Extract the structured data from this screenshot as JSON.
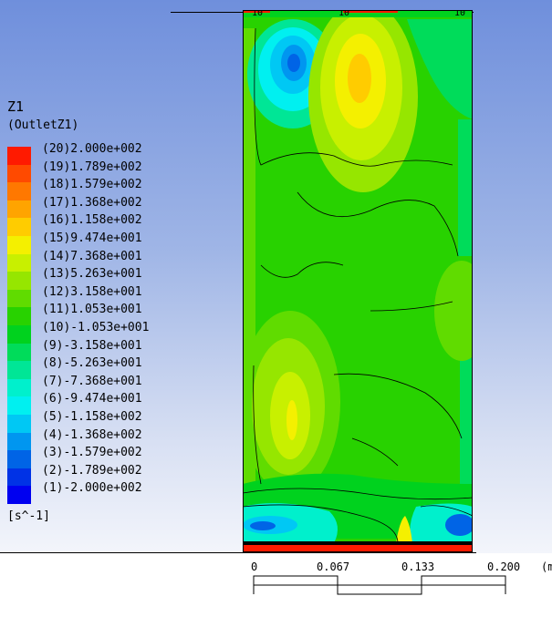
{
  "legend": {
    "title": "Z1",
    "subtitle": "(OutletZ1)",
    "units": "[s^-1]",
    "levels": [
      {
        "label": "(20)2.000e+002",
        "color": "#ff1a00"
      },
      {
        "label": "(19)1.789e+002",
        "color": "#ff4a00"
      },
      {
        "label": "(18)1.579e+002",
        "color": "#ff7800"
      },
      {
        "label": "(17)1.368e+002",
        "color": "#ffa400"
      },
      {
        "label": "(16)1.158e+002",
        "color": "#ffcc00"
      },
      {
        "label": "(15)9.474e+001",
        "color": "#f4f000"
      },
      {
        "label": "(14)7.368e+001",
        "color": "#c8f000"
      },
      {
        "label": "(13)5.263e+001",
        "color": "#96e600"
      },
      {
        "label": "(12)3.158e+001",
        "color": "#60dc00"
      },
      {
        "label": "(11)1.053e+001",
        "color": "#28d200"
      },
      {
        "label": "(10)-1.053e+001",
        "color": "#00d21e"
      },
      {
        "label": "(9)-3.158e+001",
        "color": "#00dc5a"
      },
      {
        "label": "(8)-5.263e+001",
        "color": "#00e696"
      },
      {
        "label": "(7)-7.368e+001",
        "color": "#00f0cc"
      },
      {
        "label": "(6)-9.474e+001",
        "color": "#00f0f0"
      },
      {
        "label": "(5)-1.158e+002",
        "color": "#00c8f4"
      },
      {
        "label": "(4)-1.368e+002",
        "color": "#0096f0"
      },
      {
        "label": "(3)-1.579e+002",
        "color": "#0064e6"
      },
      {
        "label": "(2)-1.789e+002",
        "color": "#0032e6"
      },
      {
        "label": "(1)-2.000e+002",
        "color": "#0000f0"
      }
    ]
  },
  "scale": {
    "ticks": [
      "0",
      "0.067",
      "0.133",
      "0.200"
    ],
    "unit_fragment": "(m"
  },
  "contour_labels": [
    "10",
    "10",
    "10"
  ]
}
